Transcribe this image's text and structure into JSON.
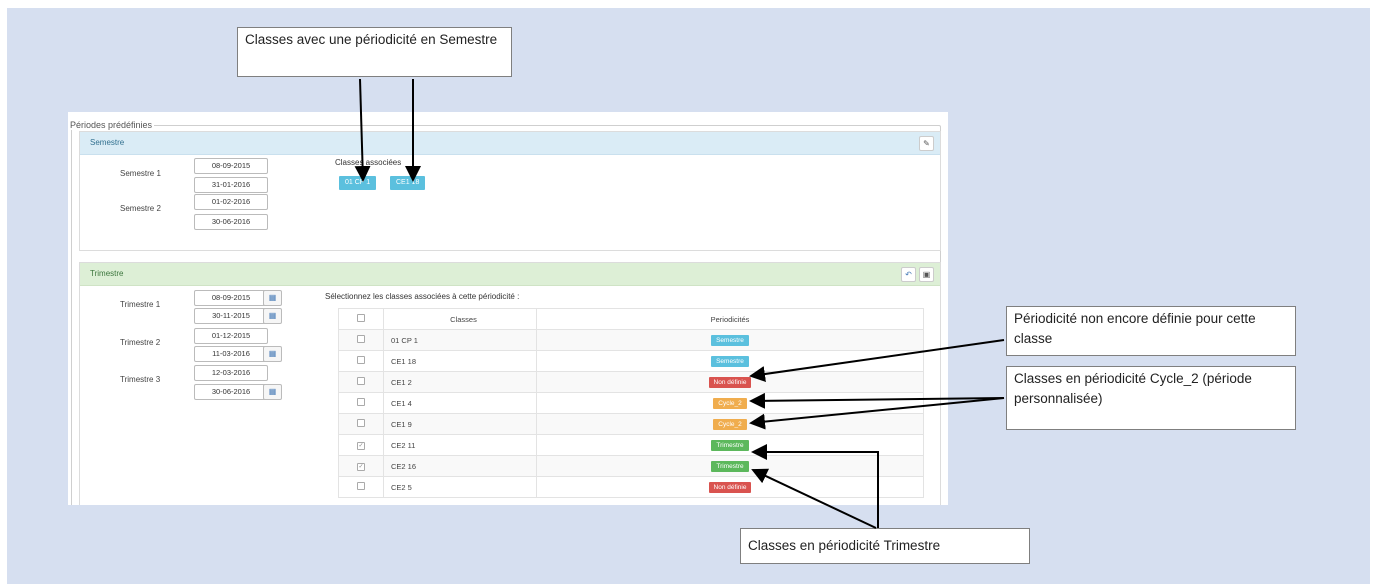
{
  "fieldset_legend": "Périodes prédéfinies",
  "semestre": {
    "title": "Semestre",
    "edit_icon": "pencil-icon",
    "periods": [
      {
        "label": "Semestre 1",
        "start": "08-09-2015",
        "end": "31-01-2016"
      },
      {
        "label": "Semestre 2",
        "start": "01-02-2016",
        "end": "30-06-2016"
      }
    ],
    "classes_label": "Classes associées",
    "classes": [
      "01 CP 1",
      "CE1 18"
    ]
  },
  "trimestre": {
    "title": "Trimestre",
    "header_icons": [
      "undo-icon",
      "save-icon"
    ],
    "periods": [
      {
        "label": "Trimestre 1",
        "start": "08-09-2015",
        "end": "30-11-2015"
      },
      {
        "label": "Trimestre 2",
        "start": "01-12-2015",
        "end": "11-03-2016"
      },
      {
        "label": "Trimestre 3",
        "start": "12-03-2016",
        "end": "30-06-2016"
      }
    ],
    "select_prompt": "Sélectionnez les classes associées à cette périodicité :",
    "table": {
      "headers": [
        "Classes",
        "Periodicités"
      ],
      "rows": [
        {
          "classe": "01 CP 1",
          "periodicite": "Semestre",
          "checked": false
        },
        {
          "classe": "CE1 18",
          "periodicite": "Semestre",
          "checked": false
        },
        {
          "classe": "CE1 2",
          "periodicite": "Non définie",
          "checked": false
        },
        {
          "classe": "CE1 4",
          "periodicite": "Cycle_2",
          "checked": false
        },
        {
          "classe": "CE1 9",
          "periodicite": "Cycle_2",
          "checked": false
        },
        {
          "classe": "CE2 11",
          "periodicite": "Trimestre",
          "checked": true
        },
        {
          "classe": "CE2 16",
          "periodicite": "Trimestre",
          "checked": true
        },
        {
          "classe": "CE2 5",
          "periodicite": "Non définie",
          "checked": false
        }
      ]
    }
  },
  "colors": {
    "semestre": "#5bc0de",
    "non_definie": "#d9534f",
    "cycle": "#f0ad4e",
    "trimestre": "#5cb85c"
  },
  "callouts": {
    "semestre_classes": "Classes avec une périodicité en Semestre",
    "non_definie": "Périodicité non encore définie pour cette classe",
    "cycle2": "Classes en périodicité Cycle_2 (période personnalisée)",
    "trimestre": "Classes en périodicité Trimestre"
  }
}
